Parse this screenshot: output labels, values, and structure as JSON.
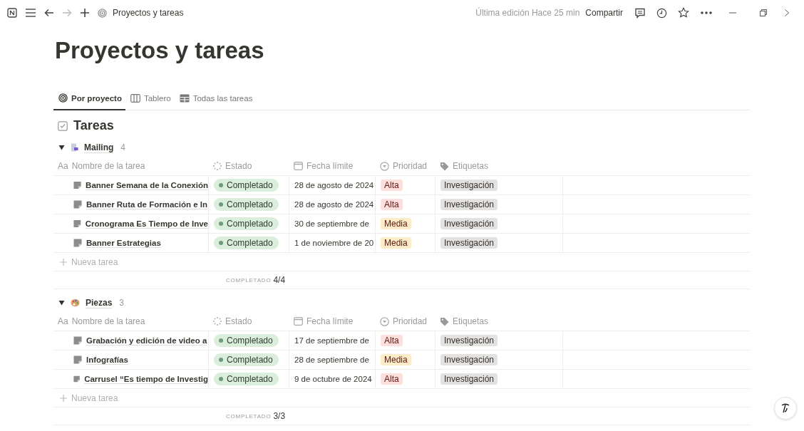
{
  "topbar": {
    "breadcrumb": "Proyectos y tareas",
    "last_edit": "Última edición Hace 25 min",
    "share": "Compartir"
  },
  "title": "Proyectos y tareas",
  "tabs": [
    {
      "label": "Por proyecto",
      "selected": true
    },
    {
      "label": "Tablero",
      "selected": false
    },
    {
      "label": "Todas las tareas",
      "selected": false
    }
  ],
  "database_title": "Tareas",
  "groups": [
    {
      "name": "Mailing",
      "count": "4",
      "expanded": true,
      "columns": [
        {
          "label": "Nombre de la tarea",
          "icon_text": "Aa"
        },
        {
          "label": "Estado"
        },
        {
          "label": "Fecha límite"
        },
        {
          "label": "Prioridad"
        },
        {
          "label": "Etiquetas"
        }
      ],
      "rows": [
        {
          "name": "Banner Semana de la Conexión",
          "status": "Completado",
          "date": "28 de agosto de 2024",
          "priority": "Alta",
          "color": "#fddfdd",
          "tag": "Investigación"
        },
        {
          "name": "Banner Ruta de Formación e In",
          "status": "Completado",
          "date": "28 de agosto de 2024",
          "priority": "Alta",
          "color": "#fddfdd",
          "tag": "Investigación"
        },
        {
          "name": "Cronograma Es Tiempo de Inve",
          "status": "Completado",
          "date": "30 de septiembre de",
          "priority": "Media",
          "color": "#fcecc8",
          "tag": "Investigación"
        },
        {
          "name": "Banner Estrategias",
          "status": "Completado",
          "date": "1 de noviembre de 20",
          "priority": "Media",
          "color": "#fcecc8",
          "tag": "Investigación"
        }
      ],
      "new_row": "Nueva tarea",
      "summary_label": "COMPLETADO",
      "summary_value": "4/4"
    },
    {
      "name": "Piezas",
      "count": "3",
      "expanded": true,
      "columns": [
        {
          "label": "Nombre de la tarea",
          "icon_text": "Aa"
        },
        {
          "label": "Estado"
        },
        {
          "label": "Fecha límite"
        },
        {
          "label": "Prioridad"
        },
        {
          "label": "Etiquetas"
        }
      ],
      "rows": [
        {
          "name": "Grabación y edición de video a",
          "status": "Completado",
          "date": "17 de septiembre de",
          "priority": "Alta",
          "color": "#fddfdd",
          "tag": "Investigación"
        },
        {
          "name": "Infografías",
          "status": "Completado",
          "date": "28 de septiembre de",
          "priority": "Media",
          "color": "#fcecc8",
          "tag": "Investigación"
        },
        {
          "name": "Carrusel “Es tiempo de Investig",
          "status": "Completado",
          "date": "9 de octubre de 2024",
          "priority": "Alta",
          "color": "#fddfdd",
          "tag": "Investigación"
        }
      ],
      "new_row": "Nueva tarea",
      "summary_label": "COMPLETADO",
      "summary_value": "3/3"
    }
  ]
}
